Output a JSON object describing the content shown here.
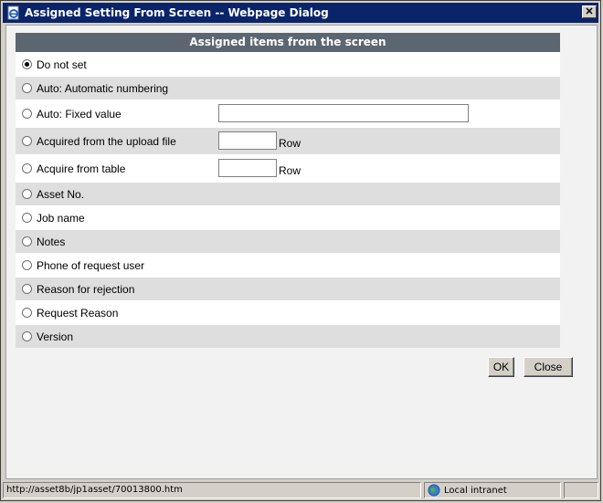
{
  "window": {
    "title": "Assigned Setting From Screen -- Webpage Dialog",
    "close_glyph": "✕"
  },
  "panel": {
    "header": "Assigned items from the screen",
    "options": [
      {
        "label": "Do not set",
        "selected": true
      },
      {
        "label": "Auto: Automatic numbering",
        "selected": false
      },
      {
        "label": "Auto: Fixed value",
        "selected": false,
        "input_value": ""
      },
      {
        "label": "Acquired from the upload file",
        "selected": false,
        "input_value": "",
        "unit": "Row"
      },
      {
        "label": "Acquire from table",
        "selected": false,
        "input_value": "",
        "unit": "Row"
      },
      {
        "label": "Asset No.",
        "selected": false
      },
      {
        "label": "Job name",
        "selected": false
      },
      {
        "label": "Notes",
        "selected": false
      },
      {
        "label": "Phone of request user",
        "selected": false
      },
      {
        "label": "Reason for rejection",
        "selected": false
      },
      {
        "label": "Request Reason",
        "selected": false
      },
      {
        "label": "Version",
        "selected": false
      }
    ]
  },
  "buttons": {
    "ok": "OK",
    "close": "Close"
  },
  "statusbar": {
    "url": "http://asset8b/jp1asset/70013800.htm",
    "zone": "Local intranet"
  },
  "colors": {
    "titlebar": "#0a246a",
    "header": "#5c6671",
    "row_alt": "#dedede"
  }
}
